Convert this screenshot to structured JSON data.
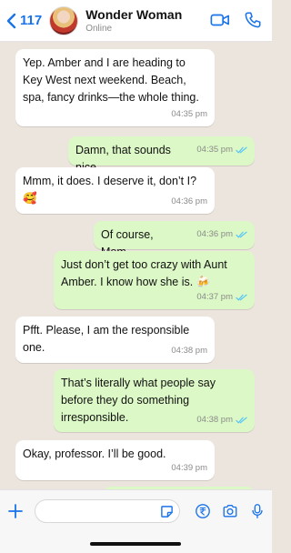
{
  "header": {
    "back_count": "117",
    "contact_name": "Wonder Woman",
    "status": "Online"
  },
  "messages": [
    {
      "direction": "in",
      "text": "Yep. Amber and I are heading to Key West next weekend. Beach, spa, fancy drinks—the whole thing.",
      "time": "04:35 pm"
    },
    {
      "direction": "out",
      "text": "Damn, that sounds nice.",
      "time": "04:35 pm",
      "status": "read"
    },
    {
      "direction": "in",
      "text": "Mmm, it does. I deserve it, don’t I? 🥰",
      "time": "04:36 pm"
    },
    {
      "direction": "out",
      "text": "Of course, Mom.",
      "time": "04:36 pm",
      "status": "read"
    },
    {
      "direction": "out",
      "text": "Just don’t get too crazy with Aunt Amber. I know how she is. 🍻",
      "time": "04:37 pm",
      "status": "read"
    },
    {
      "direction": "in",
      "text": "Pfft. Please, I am the responsible one.",
      "time": "04:38 pm"
    },
    {
      "direction": "out",
      "text": "That’s literally what people say before they do something irresponsible.",
      "time": "04:38 pm",
      "status": "read"
    },
    {
      "direction": "in",
      "text": "Okay, professor. I’ll be good.",
      "time": "04:39 pm"
    }
  ],
  "footer": {
    "input_value": "",
    "icons": [
      "plus-icon",
      "sticker-icon",
      "rupee-icon",
      "camera-icon",
      "microphone-icon"
    ]
  },
  "colors": {
    "accent": "#1a73e8",
    "incoming_bubble": "#ffffff",
    "outgoing_bubble": "#dcf8c6",
    "chat_background": "#ece5dd",
    "read_ticks": "#4fc3f7"
  }
}
